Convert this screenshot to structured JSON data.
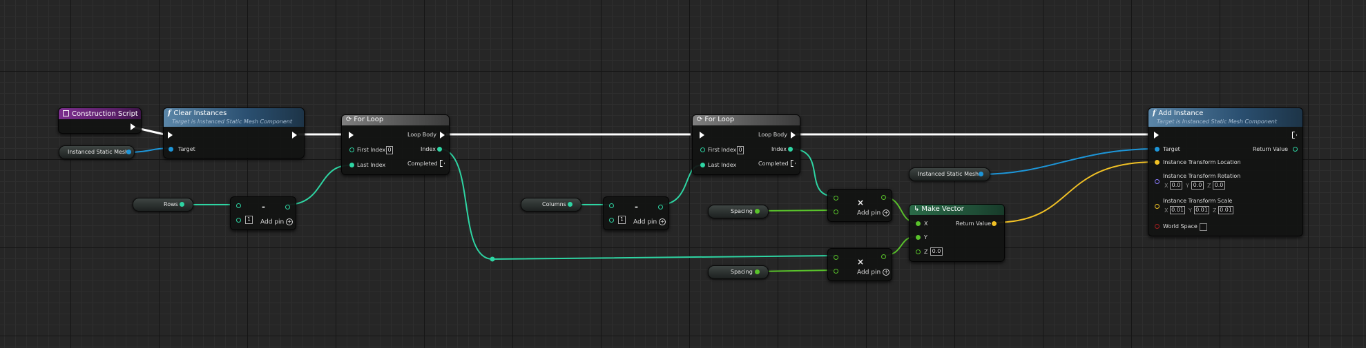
{
  "colors": {
    "exec_wire": "#ffffff",
    "object_wire": "#1d96d9",
    "int_wire": "#2ed5a3",
    "float_wire": "#59c22b",
    "vector_wire": "#f1c125",
    "transform_pin": "#e07a24",
    "bool_pin": "#a51f1f"
  },
  "construction_script": {
    "title": "Construction Script",
    "icon": "graph-icon"
  },
  "clear_instances": {
    "title": "Clear Instances",
    "subtitle": "Target is Instanced Static Mesh Component",
    "target_label": "Target",
    "icon": "function-icon"
  },
  "mesh_var_1": {
    "label": "Instanced Static Mesh"
  },
  "for_loop_1": {
    "title": "For Loop",
    "loop_body": "Loop Body",
    "index": "Index",
    "first_index": "First Index",
    "first_index_value": "0",
    "last_index": "Last Index",
    "completed": "Completed"
  },
  "rows_var": {
    "label": "Rows"
  },
  "subtract_1": {
    "op": "-",
    "value": "1",
    "add_pin": "Add pin"
  },
  "columns_var": {
    "label": "Columns"
  },
  "subtract_2": {
    "op": "-",
    "value": "1",
    "add_pin": "Add pin"
  },
  "for_loop_2": {
    "title": "For Loop",
    "loop_body": "Loop Body",
    "index": "Index",
    "first_index": "First Index",
    "first_index_value": "0",
    "last_index": "Last Index",
    "completed": "Completed"
  },
  "spacing_var_1": {
    "label": "Spacing"
  },
  "spacing_var_2": {
    "label": "Spacing"
  },
  "multiply_1": {
    "op": "×",
    "add_pin": "Add pin"
  },
  "multiply_2": {
    "op": "×",
    "add_pin": "Add pin"
  },
  "make_vector": {
    "title": "Make Vector",
    "x": "X",
    "y": "Y",
    "z": "Z",
    "z_value": "0.0",
    "return_value": "Return Value"
  },
  "mesh_var_2": {
    "label": "Instanced Static Mesh"
  },
  "add_instance": {
    "title": "Add Instance",
    "subtitle": "Target is Instanced Static Mesh Component",
    "target": "Target",
    "return_value": "Return Value",
    "location": "Instance Transform Location",
    "rotation": "Instance Transform Rotation",
    "rot_x_label": "X",
    "rot_x": "0.0",
    "rot_y_label": "Y",
    "rot_y": "0.0",
    "rot_z_label": "Z",
    "rot_z": "0.0",
    "scale": "Instance Transform Scale",
    "scale_x_label": "X",
    "scale_x": "0.01",
    "scale_y_label": "Y",
    "scale_y": "0.01",
    "scale_z_label": "Z",
    "scale_z": "0.01",
    "world_space": "World Space"
  }
}
